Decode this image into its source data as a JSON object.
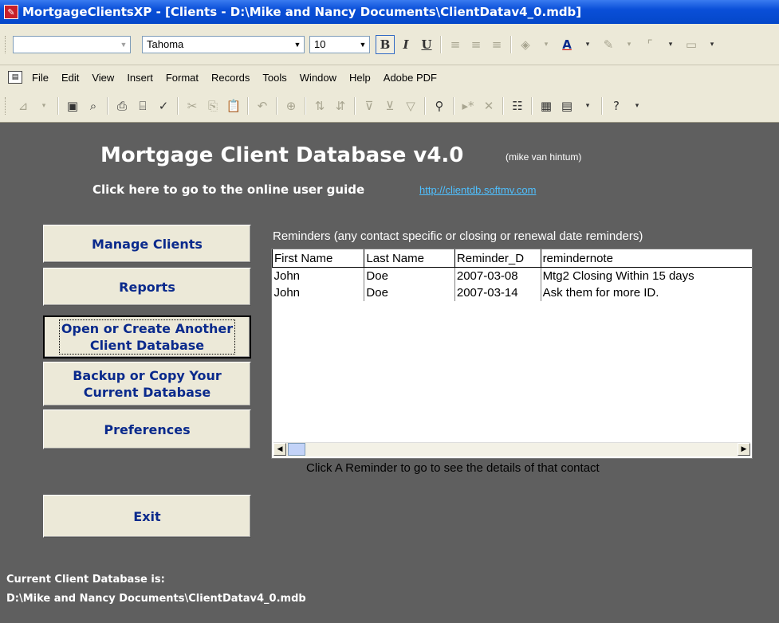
{
  "window": {
    "title": "MortgageClientsXP - [Clients - D:\\Mike and Nancy Documents\\ClientDatav4_0.mdb]"
  },
  "formatting_toolbar": {
    "object_combo": "",
    "font_name": "Tahoma",
    "font_size": "10",
    "bold": "B",
    "italic": "I",
    "underline": "U"
  },
  "menu": {
    "items": [
      "File",
      "Edit",
      "View",
      "Insert",
      "Format",
      "Records",
      "Tools",
      "Window",
      "Help",
      "Adobe PDF"
    ]
  },
  "form": {
    "heading": "Mortgage Client Database v4.0",
    "author": "(mike van hintum)",
    "guide_text": "Click here to go to the online user guide",
    "guide_link": "http://clientdb.softmv.com",
    "buttons": {
      "manage": "Manage Clients",
      "reports": "Reports",
      "open_line1": "Open or Create Another",
      "open_line2": "Client Database",
      "backup_line1": "Backup or Copy Your",
      "backup_line2": "Current Database",
      "preferences": "Preferences",
      "exit": "Exit"
    },
    "reminders_label": "Reminders (any contact specific or closing or renewal  date reminders)",
    "reminders": {
      "columns": [
        "First Name",
        "Last Name",
        "Reminder_D",
        "remindernote"
      ],
      "rows": [
        [
          "John",
          "Doe",
          "2007-03-08",
          "Mtg2 Closing  Within 15 days"
        ],
        [
          "John",
          "Doe",
          "2007-03-14",
          "Ask them for more ID."
        ]
      ]
    },
    "reminder_hint": "Click A Reminder to go to see the details of that contact",
    "current_db_label": "Current Client Database is:",
    "current_db_path": "D:\\Mike and Nancy Documents\\ClientDatav4_0.mdb"
  }
}
